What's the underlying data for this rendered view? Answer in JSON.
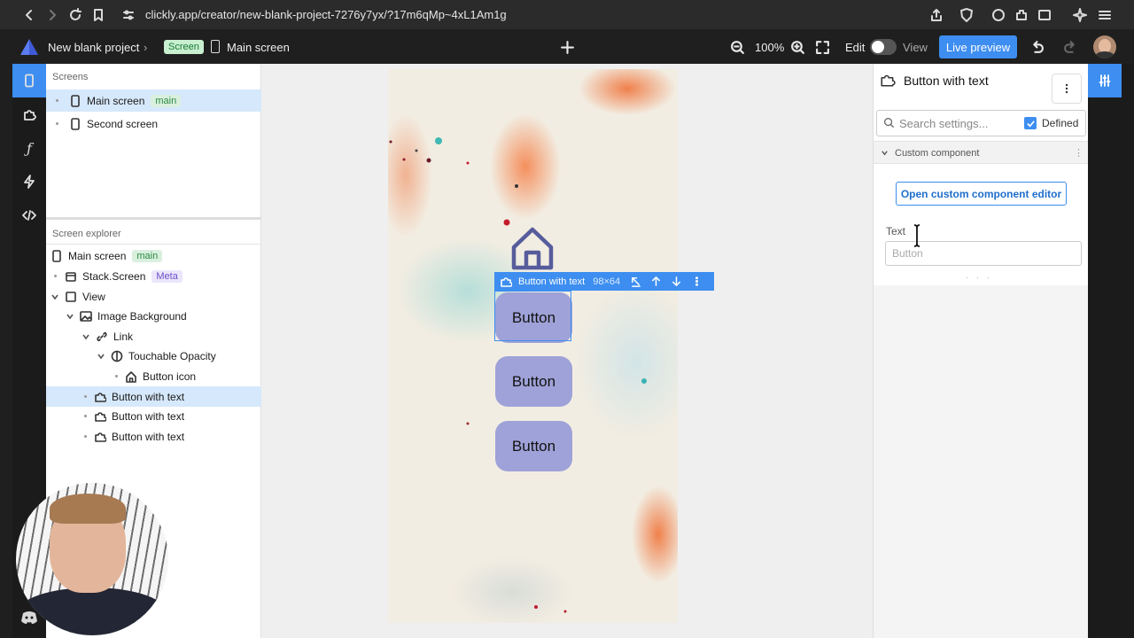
{
  "browser": {
    "url": "clickly.app/creator/new-blank-project-7276y7yx/?17m6qMp~4xL1Am1g"
  },
  "header": {
    "project": "New blank project",
    "screen_chip": "Screen",
    "screen_name": "Main screen",
    "zoom": "100%",
    "edit_label": "Edit",
    "view_label": "View",
    "live_preview": "Live preview"
  },
  "left": {
    "screens_title": "Screens",
    "screens": [
      {
        "label": "Main screen",
        "tag": "main"
      },
      {
        "label": "Second screen",
        "tag": ""
      }
    ],
    "explorer_title": "Screen explorer",
    "tree": [
      {
        "label": "Main screen",
        "tag": "main"
      },
      {
        "label": "Stack.Screen",
        "tag": "Meta"
      },
      {
        "label": "View",
        "tag": ""
      },
      {
        "label": "Image Background",
        "tag": ""
      },
      {
        "label": "Link",
        "tag": ""
      },
      {
        "label": "Touchable Opacity",
        "tag": ""
      },
      {
        "label": "Button icon",
        "tag": ""
      },
      {
        "label": "Button with text",
        "tag": ""
      },
      {
        "label": "Button with text",
        "tag": ""
      },
      {
        "label": "Button with text",
        "tag": ""
      }
    ]
  },
  "canvas": {
    "selection_label": "Button with text",
    "selection_size": "98×64",
    "buttons": [
      "Button",
      "Button",
      "Button"
    ]
  },
  "right": {
    "title": "Button with text",
    "search_placeholder": "Search settings...",
    "defined_label": "Defined",
    "section": "Custom component",
    "open_editor": "Open custom component editor",
    "text_label": "Text",
    "text_placeholder": "Button"
  },
  "colors": {
    "accent": "#3d8ef0",
    "button_fill": "#9ea2d8",
    "main_tag": "#2b8a45",
    "meta_tag": "#6a4fc7"
  }
}
